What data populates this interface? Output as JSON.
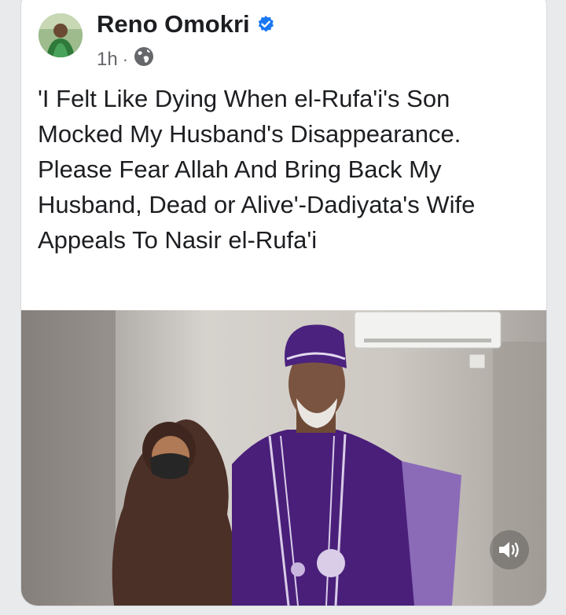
{
  "post": {
    "author": "Reno Omokri",
    "time": "1h",
    "separator": "·",
    "privacy_icon": "globe-icon",
    "verified_icon": "verified-badge-icon",
    "text": "'I Felt Like Dying When el-Rufa'i's Son Mocked My Husband's Disappearance. Please Fear Allah And Bring Back My Husband, Dead or Alive'-Dadiyata's Wife Appeals To Nasir el-Rufa'i"
  },
  "media": {
    "type": "video",
    "sound_icon": "speaker-icon"
  },
  "colors": {
    "verified": "#1877f2",
    "text": "#1c1e21",
    "meta": "#65676b",
    "agbada": "#4a1f7a"
  }
}
